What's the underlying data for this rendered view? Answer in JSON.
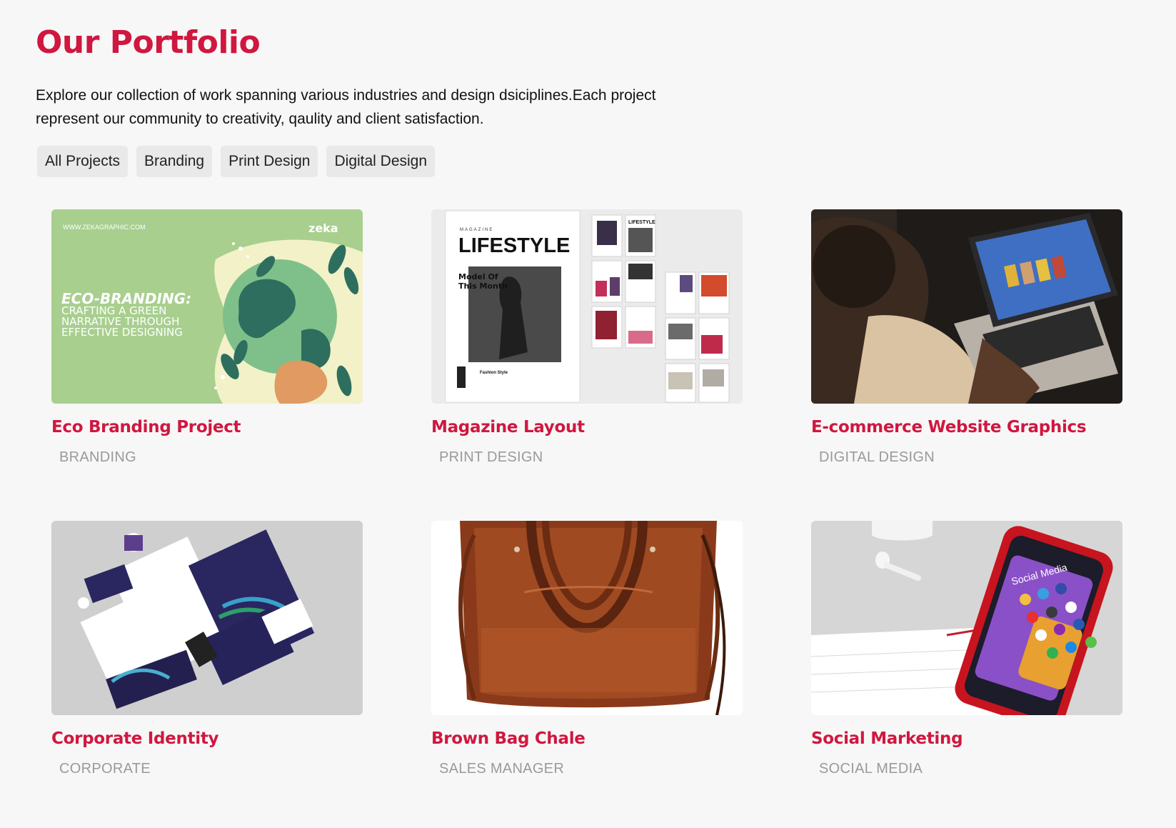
{
  "header": {
    "title": "Our Portfolio",
    "intro_line1": "Explore our collection of work spanning various industries and design dsiciplines.Each project",
    "intro_line2": "represent our community to creativity, qaulity and client satisfaction."
  },
  "filters": [
    "All Projects",
    "Branding",
    "Print Design",
    "Digital Design"
  ],
  "projects": [
    {
      "title": "Eco Branding Project",
      "category": "BRANDING",
      "image": {
        "site": "WWW.ZEKAGRAPHIC.COM",
        "logo": "zeka",
        "headline": "ECO-BRANDING:",
        "line1": "CRAFTING A GREEN",
        "line2": "NARRATIVE THROUGH",
        "line3": "EFFECTIVE DESIGNING"
      }
    },
    {
      "title": "Magazine Layout",
      "category": "PRINT DESIGN",
      "image": {
        "kicker": "MAGAZINE",
        "masthead": "LIFESTYLE",
        "feature1": "Model Of",
        "feature2": "This Month",
        "small_masthead": "LIFESTYLE",
        "footer": "Fashion Style"
      }
    },
    {
      "title": "E-commerce Website Graphics",
      "category": "DIGITAL DESIGN"
    },
    {
      "title": "Corporate Identity",
      "category": "CORPORATE"
    },
    {
      "title": "Brown Bag Chale",
      "category": "SALES MANAGER"
    },
    {
      "title": "Social Marketing",
      "category": "SOCIAL MEDIA",
      "image": {
        "phone_text": "Social Media"
      }
    }
  ],
  "colors": {
    "accent": "#d0173f",
    "muted": "#9a9a9a",
    "chip": "#e9e9e9",
    "background": "#f7f7f7"
  }
}
